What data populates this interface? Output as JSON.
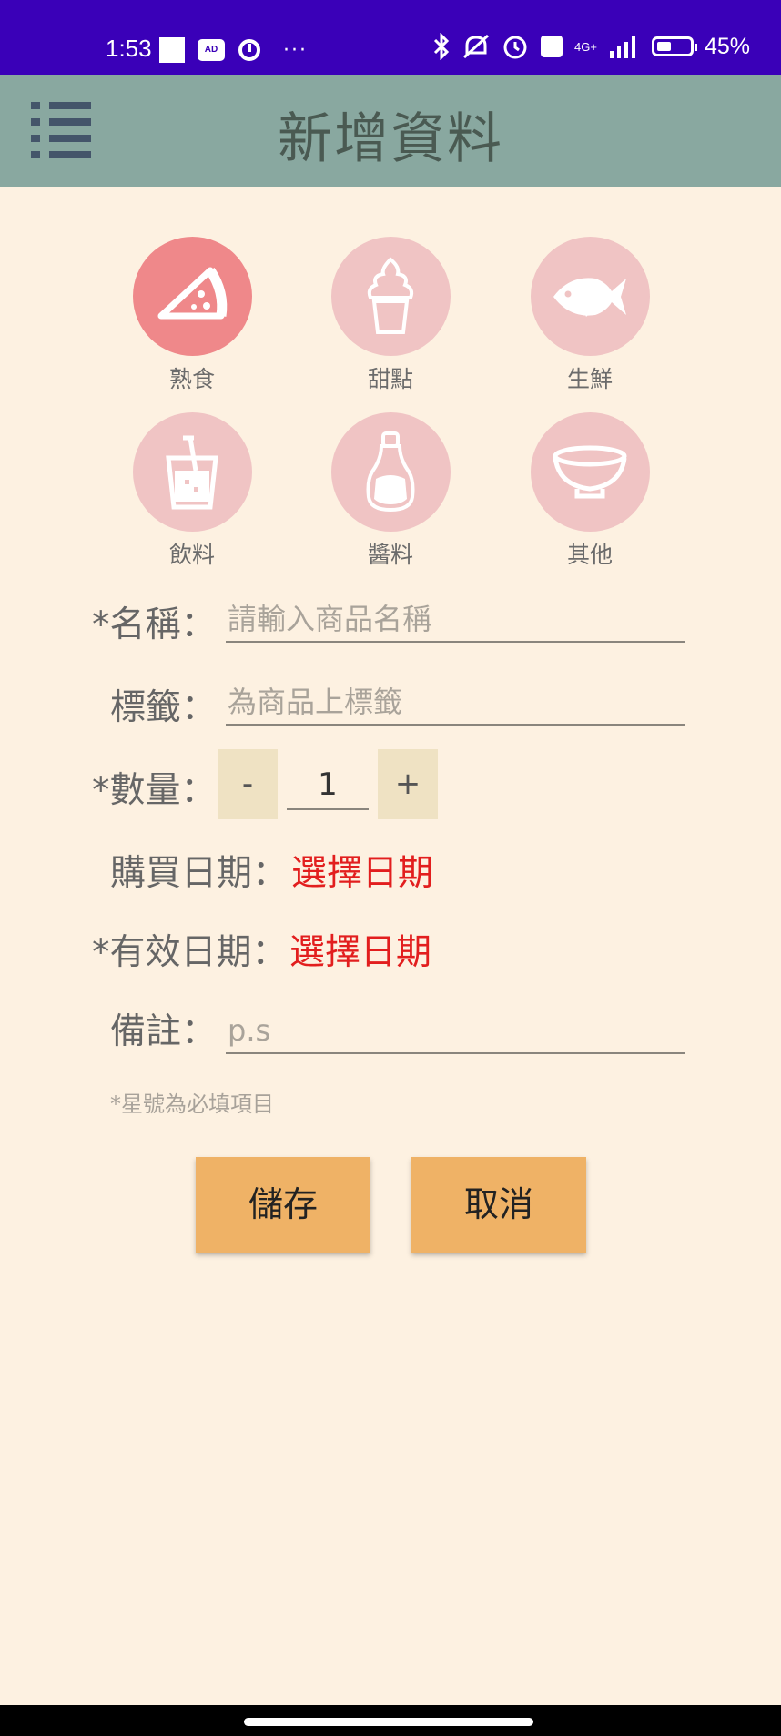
{
  "status_bar": {
    "time": "1:53",
    "ad_badge": "AD",
    "more": "···",
    "network": "4G+",
    "battery_percent": "45%",
    "battery_level": 0.45
  },
  "app_bar": {
    "title": "新增資料"
  },
  "categories": [
    {
      "label": "熟食",
      "icon": "pizza-icon",
      "selected": true
    },
    {
      "label": "甜點",
      "icon": "ice-cream-icon",
      "selected": false
    },
    {
      "label": "生鮮",
      "icon": "fish-icon",
      "selected": false
    },
    {
      "label": "飲料",
      "icon": "drink-cup-icon",
      "selected": false
    },
    {
      "label": "醬料",
      "icon": "sauce-bottle-icon",
      "selected": false
    },
    {
      "label": "其他",
      "icon": "bowl-icon",
      "selected": false
    }
  ],
  "form": {
    "name_label": "*名稱：",
    "name_placeholder": "請輸入商品名稱",
    "tag_label": "標籤：",
    "tag_placeholder": "為商品上標籤",
    "quantity_label": "*數量：",
    "minus": "-",
    "quantity": "1",
    "plus": "+",
    "purchase_date_label": "購買日期：",
    "purchase_date_value": "選擇日期",
    "expiry_date_label": "*有效日期：",
    "expiry_date_value": "選擇日期",
    "note_label": "備註：",
    "note_placeholder": "p.s",
    "required_hint": "*星號為必填項目"
  },
  "buttons": {
    "save": "儲存",
    "cancel": "取消"
  },
  "colors": {
    "status_bar": "#3a00b8",
    "app_bar": "#89a8a0",
    "background": "#fdf1e1",
    "category_selected": "#ef888a",
    "category_default": "#f0c4c4",
    "date_link": "#e21e1e",
    "button": "#efb266",
    "stepper": "#efe2c3"
  }
}
